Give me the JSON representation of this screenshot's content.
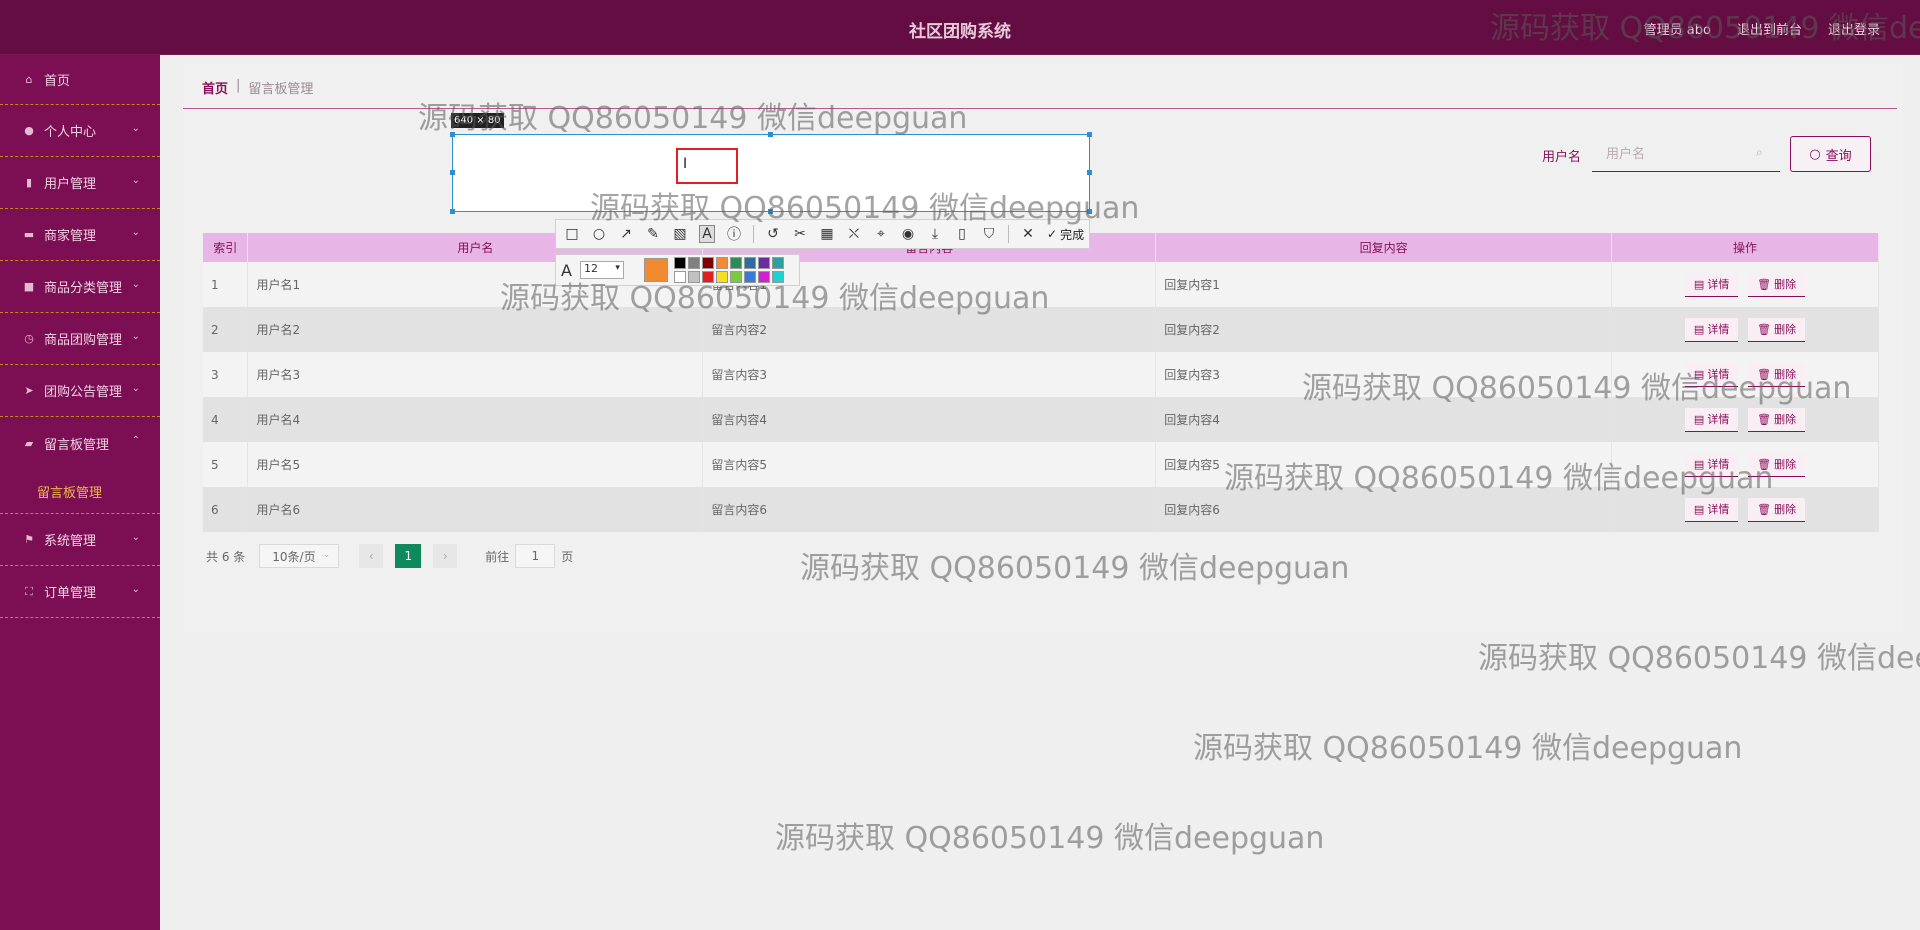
{
  "header": {
    "title": "社区团购系统",
    "admin": "管理员 abo",
    "exit_front": "退出到前台",
    "logout": "退出登录"
  },
  "sidebar": {
    "items": [
      {
        "label": "首页",
        "icon": "home-icon"
      },
      {
        "label": "个人中心",
        "icon": "user-icon"
      },
      {
        "label": "用户管理",
        "icon": "bar-chart-icon"
      },
      {
        "label": "商家管理",
        "icon": "shop-icon"
      },
      {
        "label": "商品分类管理",
        "icon": "box-icon"
      },
      {
        "label": "商品团购管理",
        "icon": "clock-icon"
      },
      {
        "label": "团购公告管理",
        "icon": "send-icon"
      },
      {
        "label": "留言板管理",
        "icon": "message-icon"
      },
      {
        "label": "系统管理",
        "icon": "flag-icon"
      },
      {
        "label": "订单管理",
        "icon": "expand-icon"
      }
    ],
    "submenu": {
      "label": "留言板管理"
    }
  },
  "breadcrumb": {
    "home": "首页",
    "separator": "|",
    "current": "留言板管理"
  },
  "search": {
    "label": "用户名",
    "placeholder": "用户名",
    "button": "查询"
  },
  "table": {
    "headers": {
      "index": "索引",
      "username": "用户名",
      "message": "留言内容",
      "reply": "回复内容",
      "actions": "操作"
    },
    "rows": [
      {
        "index": "1",
        "username": "用户名1",
        "message": "留言内容1",
        "reply": "回复内容1"
      },
      {
        "index": "2",
        "username": "用户名2",
        "message": "留言内容2",
        "reply": "回复内容2"
      },
      {
        "index": "3",
        "username": "用户名3",
        "message": "留言内容3",
        "reply": "回复内容3"
      },
      {
        "index": "4",
        "username": "用户名4",
        "message": "留言内容4",
        "reply": "回复内容4"
      },
      {
        "index": "5",
        "username": "用户名5",
        "message": "留言内容5",
        "reply": "回复内容5"
      },
      {
        "index": "6",
        "username": "用户名6",
        "message": "留言内容6",
        "reply": "回复内容6"
      }
    ],
    "detail_label": "详情",
    "delete_label": "删除"
  },
  "pagination": {
    "total": "共 6 条",
    "page_size": "10条/页",
    "current_page": "1",
    "goto_label": "前往",
    "goto_value": "1",
    "page_suffix": "页"
  },
  "screenshot_tool": {
    "size_label": "640 × 80",
    "done_label": "完成",
    "font_size": "12",
    "current_color": "#f28a30",
    "palette": [
      "#000000",
      "#808080",
      "#800000",
      "#f28a30",
      "#2e8b57",
      "#2e6e9e",
      "#6a2ca0",
      "#2aa0a0",
      "#ffffff",
      "#c0c0c0",
      "#e02020",
      "#f5e020",
      "#7ac943",
      "#3a7bd5",
      "#d020d0",
      "#20d0d0"
    ]
  },
  "watermark": "源码获取 QQ86050149 微信deepguan"
}
